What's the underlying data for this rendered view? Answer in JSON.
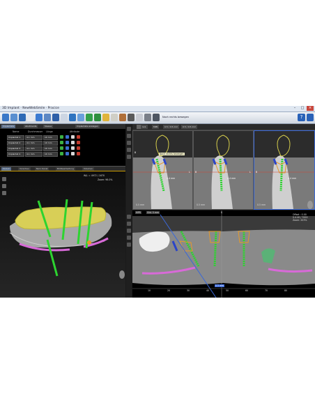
{
  "window": {
    "title": "3D Implant · NewWebSmile · Pracice"
  },
  "toolbar": {
    "label_a": "Nach rechts bewegen",
    "help": "?"
  },
  "panel": {
    "tabs": [
      "Implantate",
      "Abutments",
      "Sleeve",
      "Implantate anzeigen"
    ],
    "columns": [
      "Name",
      "Durchmesser",
      "Länge",
      "Attribute"
    ],
    "rows": [
      {
        "name": "Implantat 1",
        "diameter": "4.1 mm",
        "length": "10 mm"
      },
      {
        "name": "Implantat 2",
        "diameter": "4.1 mm",
        "length": "10 mm"
      },
      {
        "name": "Implantat 3",
        "diameter": "4.1 mm",
        "length": "10 mm"
      },
      {
        "name": "Implantat 4",
        "diameter": "4.1 mm",
        "length": "10 mm"
      }
    ]
  },
  "view_tabs": [
    "Modell",
    "Vorschau",
    "Nerv Kanal",
    "Bildbearbeitung",
    "Volumen"
  ],
  "view3d": {
    "wl": "W/L = 4972 / 1670",
    "zoom": "Zoom: 96.0%"
  },
  "slice_toolbar": {
    "tools": [
      "1x1",
      "MPR",
      "0.5 / 0.5 mm",
      "0.5 / 0.5 mm"
    ],
    "tooltip": "Nach rechts bewegen"
  },
  "slices": [
    {
      "marker_left": "B",
      "marker_right": "L",
      "mm": "4.4 mm",
      "scale": "0.5 mm"
    },
    {
      "marker_left": "B",
      "marker_right": "L",
      "mm": "4.4 mm",
      "scale": "0.5 mm"
    },
    {
      "marker_left": "B",
      "marker_right": "L",
      "mm": "4.4 mm",
      "scale": "0.5 mm"
    }
  ],
  "pano": {
    "tools": [
      "MPR",
      "Slid. 5 mm"
    ],
    "top_marker": "S",
    "info": [
      "Offset : 0.00",
      "S-4.40 / 7000",
      "Zoom: 203%"
    ],
    "ticks": [
      "10",
      "20",
      "30",
      "40",
      "50",
      "60",
      "70",
      "80"
    ],
    "ruler": "0.5 mm"
  }
}
